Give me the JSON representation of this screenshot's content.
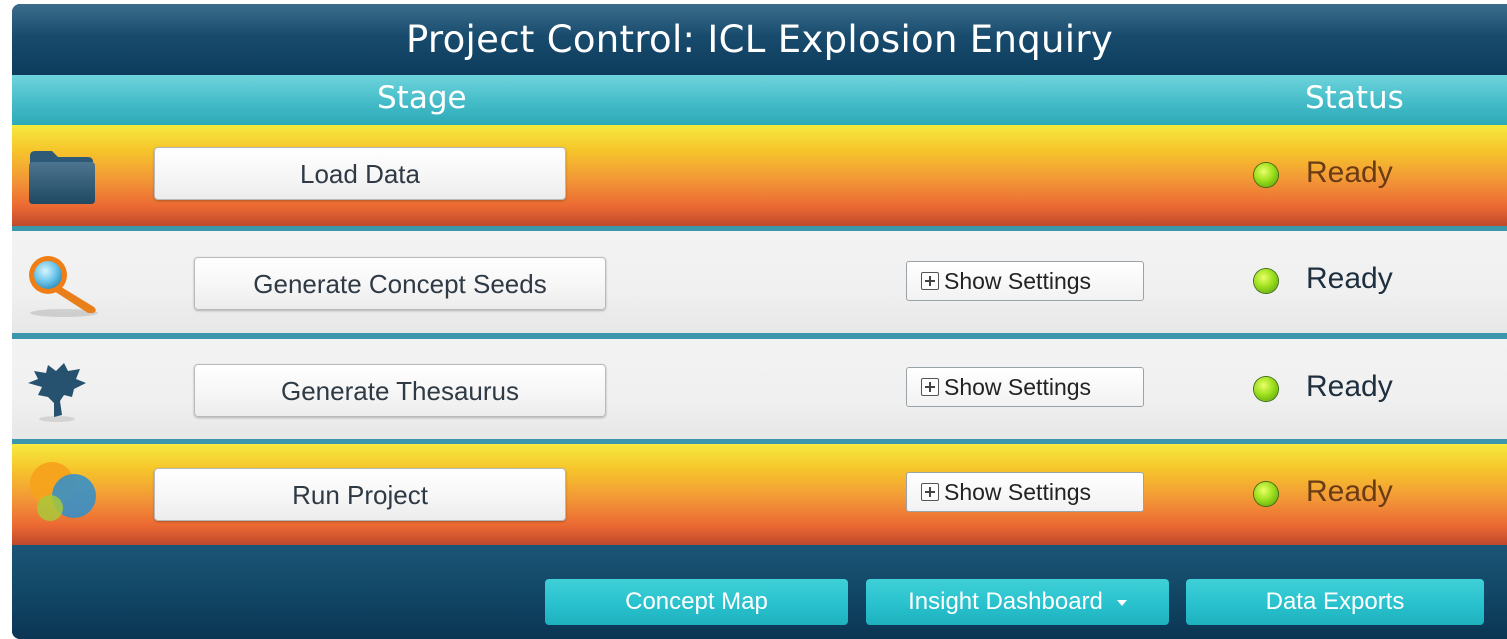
{
  "window": {
    "title": "Project Control: ICL Explosion Enquiry"
  },
  "columns": {
    "stage": "Stage",
    "status": "Status"
  },
  "rows": [
    {
      "icon": "folder-icon",
      "action_label": "Load Data",
      "settings_label": "",
      "status": "Ready"
    },
    {
      "icon": "magnifier-icon",
      "action_label": "Generate Concept Seeds",
      "settings_label": "Show Settings",
      "status": "Ready"
    },
    {
      "icon": "tree-icon",
      "action_label": "Generate Thesaurus",
      "settings_label": "Show Settings",
      "status": "Ready"
    },
    {
      "icon": "bubbles-icon",
      "action_label": "Run Project",
      "settings_label": "Show Settings",
      "status": "Ready"
    }
  ],
  "footer": {
    "buttons": [
      {
        "label": "Concept Map"
      },
      {
        "label": "Insight Dashboard",
        "has_dropdown": true
      },
      {
        "label": "Data Exports"
      }
    ]
  },
  "colors": {
    "title_bar": "#184b6d",
    "header_bar": "#44bcc8",
    "orange_row": "#f29637",
    "light_row": "#f0f0f0",
    "footer_button": "#27c0cc",
    "status_ready": "#9ee01d"
  }
}
